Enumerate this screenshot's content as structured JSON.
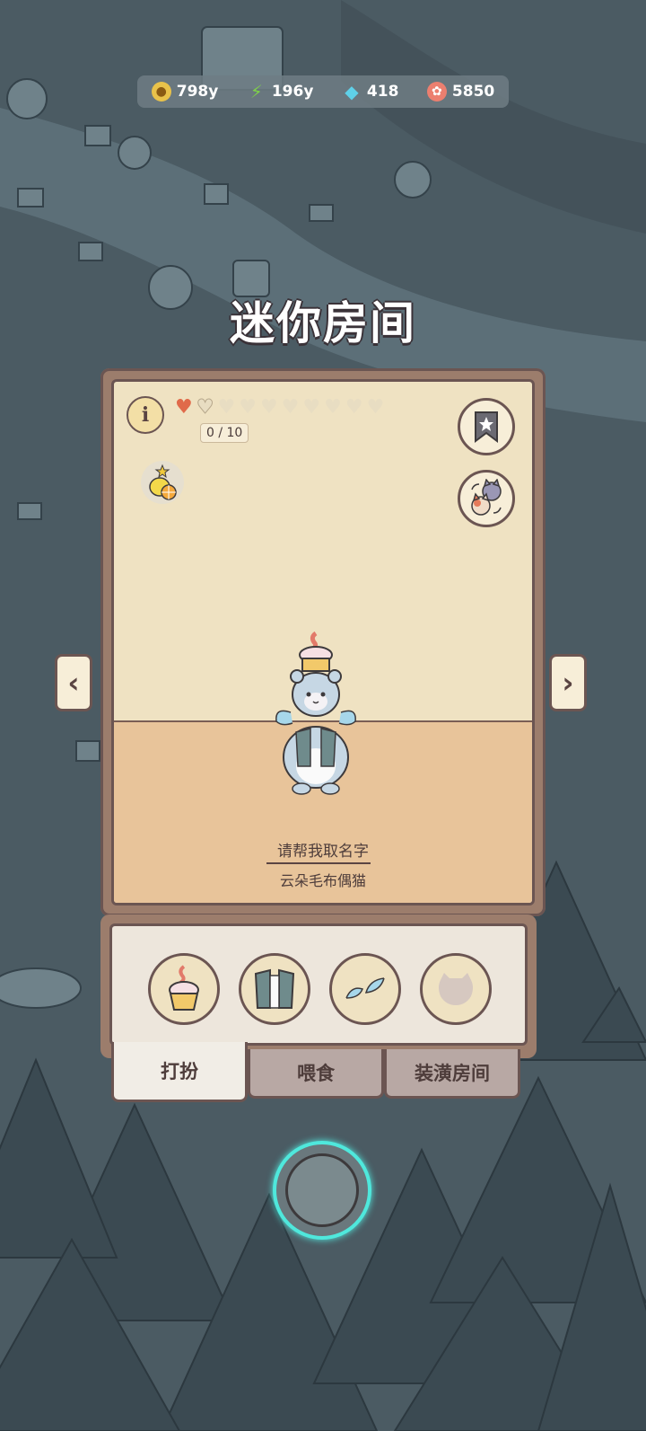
{
  "currency": {
    "gold": "798y",
    "energy": "196y",
    "gems": "418",
    "candy": "5850"
  },
  "title": "迷你房间",
  "room": {
    "hearts_total": 10,
    "hearts_filled": 1,
    "hearts_progress": "0 / 10",
    "name_prompt": "请帮我取名字",
    "cat_type": "云朵毛布偶猫"
  },
  "tabs": {
    "dress_up": "打扮",
    "feed": "喂食",
    "decorate": "装潢房间"
  },
  "icons": {
    "info": "i",
    "left_arrow": "‹",
    "right_arrow": "›"
  },
  "colors": {
    "panel_brown": "#9c7d6c",
    "room_wall": "#efe2c2",
    "room_floor": "#e8c49a",
    "accent_glow": "#4fe8dc",
    "heart_red": "#e06a4a"
  }
}
